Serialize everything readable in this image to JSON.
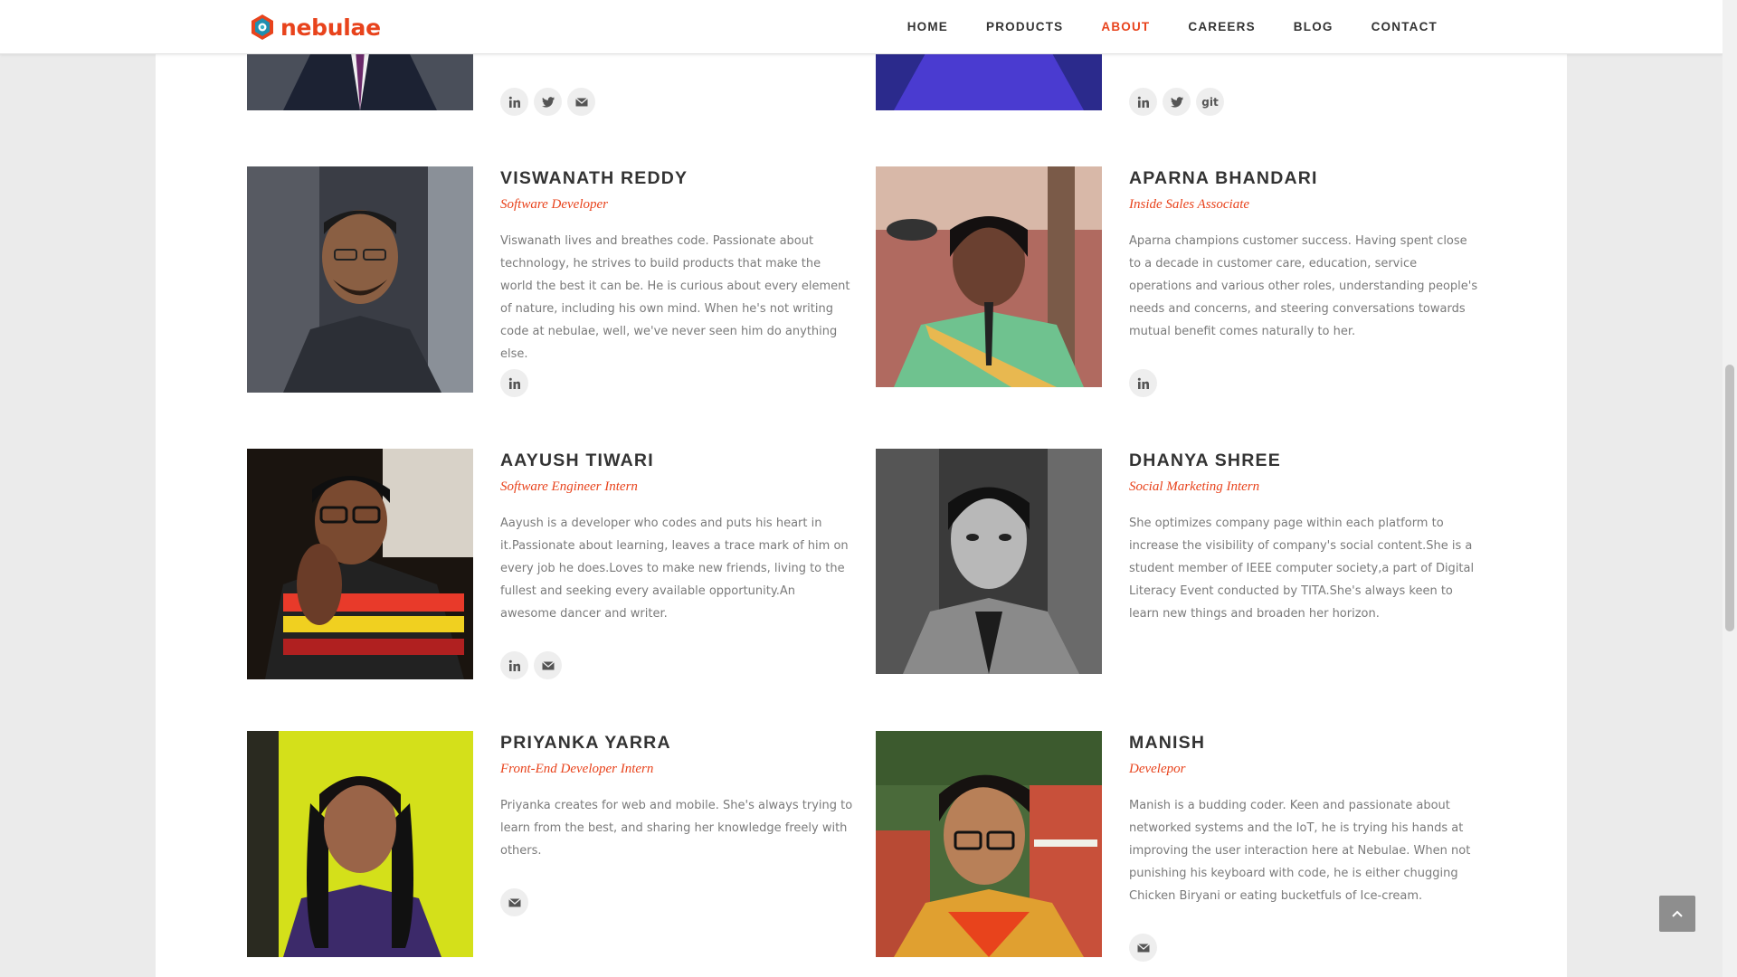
{
  "brand": {
    "name": "nebulae",
    "accent": "#e8431c"
  },
  "nav": {
    "items": [
      {
        "label": "HOME",
        "active": false
      },
      {
        "label": "PRODUCTS",
        "active": false
      },
      {
        "label": "ABOUT",
        "active": true
      },
      {
        "label": "CAREERS",
        "active": false
      },
      {
        "label": "BLOG",
        "active": false
      },
      {
        "label": "CONTACT",
        "active": false
      }
    ]
  },
  "team": {
    "top_left": {
      "socials": [
        "linkedin-icon",
        "twitter-icon",
        "email-icon"
      ]
    },
    "top_right": {
      "socials": [
        "linkedin-icon",
        "twitter-icon",
        "github-icon"
      ],
      "git_label": "git"
    },
    "members": [
      {
        "name": "VISWANATH REDDY",
        "role": "Software Developer",
        "bio": "Viswanath lives and breathes code. Passionate about technology, he strives to build products that make the world the best it can be. He is curious about every element of nature, including his own mind. When he's not writing code at nebulae, well, we've never seen him do anything else.",
        "socials": [
          "linkedin-icon"
        ]
      },
      {
        "name": "APARNA BHANDARI",
        "role": "Inside Sales Associate",
        "bio": "Aparna champions customer success. Having spent close to a decade in customer care, education, service operations and various other roles, understanding people's needs and concerns, and steering conversations towards mutual benefit comes naturally to her.",
        "socials": [
          "linkedin-icon"
        ]
      },
      {
        "name": "AAYUSH TIWARI",
        "role": "Software Engineer Intern",
        "bio": "Aayush is a developer who codes and puts his heart in it.Passionate about learning, leaves a trace mark of him on every job he does.Loves to make new friends, living to the fullest and seeking every available opportunity.An awesome dancer and writer.",
        "socials": [
          "linkedin-icon",
          "email-icon"
        ]
      },
      {
        "name": "DHANYA SHREE",
        "role": "Social Marketing Intern",
        "bio": "She optimizes company page within each platform to increase the visibility of company's social content.She is a student member of IEEE computer society,a part of Digital Literacy Event conducted by TITA.She's always keen to learn new things and broaden her horizon.",
        "socials": []
      },
      {
        "name": "PRIYANKA YARRA",
        "role": "Front-End Developer Intern",
        "bio": "Priyanka creates for web and mobile. She's always trying to learn from the best, and sharing her knowledge freely with others.",
        "socials": [
          "email-icon"
        ]
      },
      {
        "name": "MANISH",
        "role": "Develepor",
        "bio": "Manish is a budding coder. Keen and passionate about networked systems and the IoT, he is trying his hands at improving the user interaction here at Nebulae. When not punishing his keyboard with code, he is either chugging Chicken Biryani or eating bucketfuls of Ice-cream.",
        "socials": [
          "email-icon"
        ]
      }
    ]
  }
}
